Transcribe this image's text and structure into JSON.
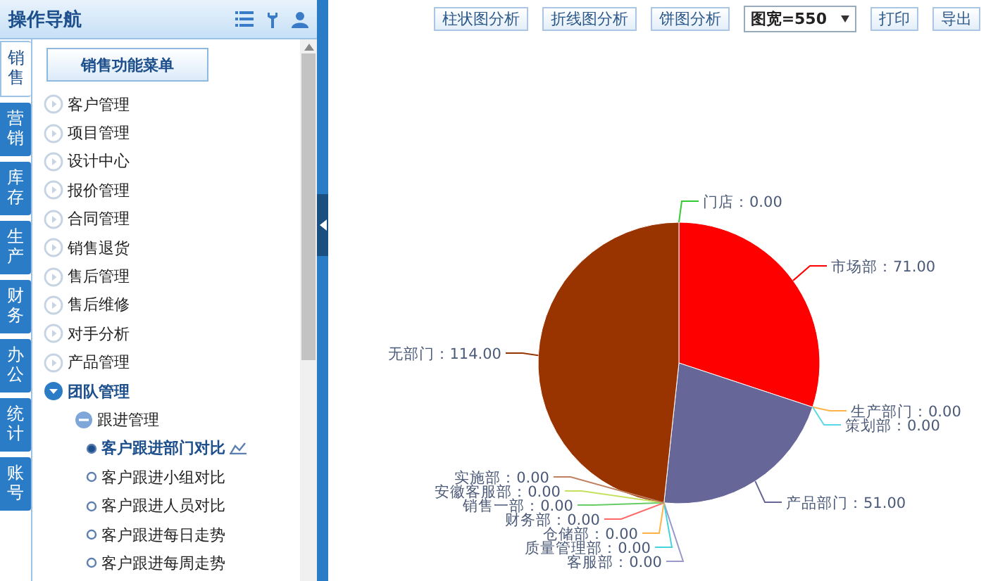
{
  "sidebar": {
    "title": "操作导航",
    "tabs": [
      {
        "label": "销售",
        "selected": true
      },
      {
        "label": "营销",
        "selected": false
      },
      {
        "label": "库存",
        "selected": false
      },
      {
        "label": "生产",
        "selected": false
      },
      {
        "label": "财务",
        "selected": false
      },
      {
        "label": "办公",
        "selected": false
      },
      {
        "label": "统计",
        "selected": false
      },
      {
        "label": "账号",
        "selected": false
      }
    ],
    "menu_button": "销售功能菜单",
    "menu": [
      {
        "label": "客户管理",
        "expanded": false
      },
      {
        "label": "项目管理",
        "expanded": false
      },
      {
        "label": "设计中心",
        "expanded": false
      },
      {
        "label": "报价管理",
        "expanded": false
      },
      {
        "label": "合同管理",
        "expanded": false
      },
      {
        "label": "销售退货",
        "expanded": false
      },
      {
        "label": "售后管理",
        "expanded": false
      },
      {
        "label": "售后维修",
        "expanded": false
      },
      {
        "label": "对手分析",
        "expanded": false
      },
      {
        "label": "产品管理",
        "expanded": false
      },
      {
        "label": "团队管理",
        "expanded": true,
        "children": [
          {
            "label": "跟进管理",
            "expanded": true,
            "children": [
              {
                "label": "客户跟进部门对比",
                "selected": true
              },
              {
                "label": "客户跟进小组对比",
                "selected": false
              },
              {
                "label": "客户跟进人员对比",
                "selected": false
              },
              {
                "label": "客户跟进每日走势",
                "selected": false
              },
              {
                "label": "客户跟进每周走势",
                "selected": false
              }
            ]
          }
        ]
      }
    ]
  },
  "toolbar": {
    "buttons": [
      "柱状图分析",
      "折线图分析",
      "饼图分析"
    ],
    "width_select": "图宽=550",
    "actions": [
      "打印",
      "导出"
    ]
  },
  "chart_data": {
    "type": "pie",
    "values": [
      0,
      71,
      0,
      0,
      51,
      0,
      0,
      0,
      0,
      0,
      0,
      0,
      114
    ],
    "value_labels": [
      "门店：0.00",
      "市场部：71.00",
      "生产部门：0.00",
      "策划部：0.00",
      "产品部门：51.00",
      "客服部：0.00",
      "质量管理部：0.00",
      "仓储部：0.00",
      "财务部：0.00",
      "销售一部：0.00",
      "安徽客服部：0.00",
      "实施部：0.00",
      "无部门：114.00"
    ]
  }
}
